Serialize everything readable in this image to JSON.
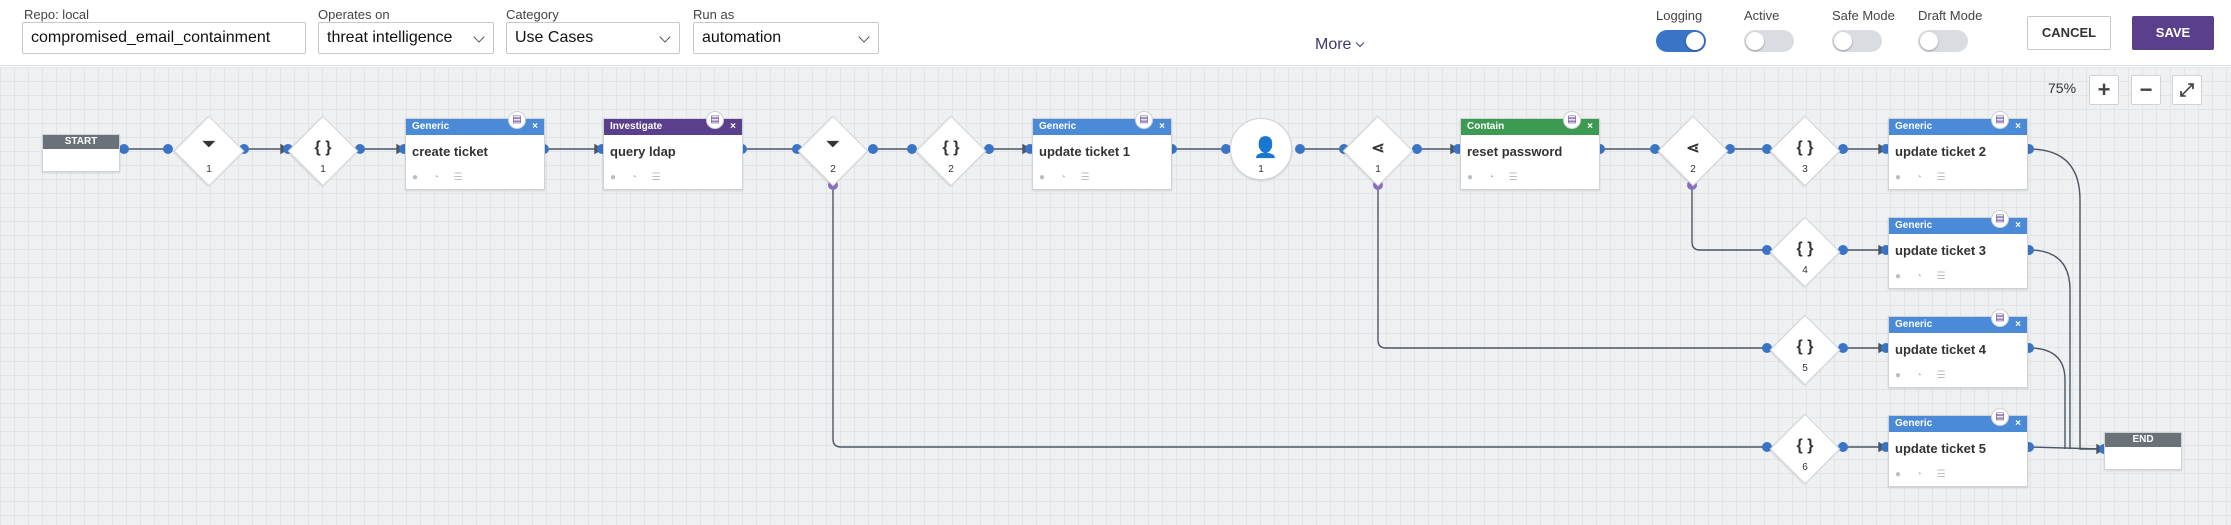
{
  "header": {
    "repo_label": "Repo: local",
    "name_value": "compromised_email_containment",
    "operates_on_label": "Operates on",
    "operates_on_value": "threat intelligence",
    "category_label": "Category",
    "category_value": "Use Cases",
    "run_as_label": "Run as",
    "run_as_value": "automation",
    "more_label": "More",
    "toggles": {
      "logging": {
        "label": "Logging",
        "on": true
      },
      "active": {
        "label": "Active",
        "on": false
      },
      "safe_mode": {
        "label": "Safe Mode",
        "on": false
      },
      "draft_mode": {
        "label": "Draft Mode",
        "on": false
      }
    },
    "cancel_label": "CANCEL",
    "save_label": "SAVE"
  },
  "canvas": {
    "zoom": "75%",
    "zoom_in": "+",
    "zoom_out": "−",
    "fit": "⤢",
    "start_label": "START",
    "end_label": "END",
    "blocks": [
      {
        "type": "Generic",
        "title": "create ticket"
      },
      {
        "type": "Investigate",
        "title": "query ldap"
      },
      {
        "type": "Generic",
        "title": "update ticket 1"
      },
      {
        "type": "Contain",
        "title": "reset password"
      },
      {
        "type": "Generic",
        "title": "update ticket 2"
      },
      {
        "type": "Generic",
        "title": "update ticket 3"
      },
      {
        "type": "Generic",
        "title": "update ticket 4"
      },
      {
        "type": "Generic",
        "title": "update ticket 5"
      }
    ],
    "diamonds": [
      {
        "icon": "filter",
        "num": "1"
      },
      {
        "icon": "{ }",
        "num": "1"
      },
      {
        "icon": "filter",
        "num": "2"
      },
      {
        "icon": "{ }",
        "num": "2"
      },
      {
        "icon": "decision",
        "num": "1"
      },
      {
        "icon": "decision",
        "num": "2"
      },
      {
        "icon": "{ }",
        "num": "3"
      },
      {
        "icon": "{ }",
        "num": "4"
      },
      {
        "icon": "{ }",
        "num": "5"
      },
      {
        "icon": "{ }",
        "num": "6"
      }
    ],
    "prompt_num": "1"
  },
  "colors": {
    "generic": "#4a8ad6",
    "investigate": "#5a3f8c",
    "contain": "#3d9a52",
    "save": "#5a3f8c",
    "wire": "#4b5563",
    "port": "#3a74c6",
    "port_purple": "#8b6fbf"
  }
}
